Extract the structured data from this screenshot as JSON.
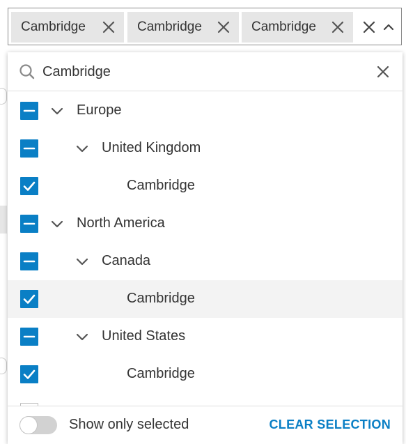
{
  "field": {
    "chips": [
      {
        "label": "Cambridge"
      },
      {
        "label": "Cambridge"
      },
      {
        "label": "Cambridge"
      }
    ],
    "icons": {
      "chip_remove": "close-icon",
      "clear_all": "close-icon",
      "collapse": "chevron-up-icon"
    }
  },
  "dropdown": {
    "search": {
      "value": "Cambridge",
      "icon": "search-icon",
      "clear_icon": "close-icon"
    },
    "tree": [
      {
        "label": "Europe",
        "level": 0,
        "state": "indeterminate",
        "expanded": true
      },
      {
        "label": "United Kingdom",
        "level": 1,
        "state": "indeterminate",
        "expanded": true
      },
      {
        "label": "Cambridge",
        "level": 2,
        "state": "checked"
      },
      {
        "label": "North America",
        "level": 0,
        "state": "indeterminate",
        "expanded": true
      },
      {
        "label": "Canada",
        "level": 1,
        "state": "indeterminate",
        "expanded": true
      },
      {
        "label": "Cambridge",
        "level": 2,
        "state": "checked",
        "hovered": true
      },
      {
        "label": "United States",
        "level": 1,
        "state": "indeterminate",
        "expanded": true
      },
      {
        "label": "Cambridge",
        "level": 2,
        "state": "checked"
      },
      {
        "label": "",
        "level": 0,
        "state": "unchecked"
      }
    ],
    "footer": {
      "toggle_label": "Show only selected",
      "toggle_on": false,
      "clear_label": "CLEAR SELECTION"
    }
  },
  "colors": {
    "accent": "#0a7fc5",
    "chip_bg": "#e6e6e6",
    "hover_row": "#f3f3f3",
    "toggle_track": "#d2d2d2"
  }
}
